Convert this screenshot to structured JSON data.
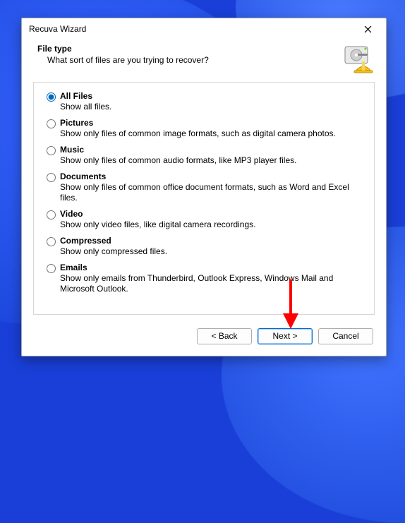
{
  "window": {
    "title": "Recuva Wizard"
  },
  "header": {
    "title": "File type",
    "subtitle": "What sort of files are you trying to recover?"
  },
  "options": [
    {
      "id": "all",
      "label": "All Files",
      "desc": "Show all files.",
      "checked": true
    },
    {
      "id": "pictures",
      "label": "Pictures",
      "desc": "Show only files of common image formats, such as digital camera photos.",
      "checked": false
    },
    {
      "id": "music",
      "label": "Music",
      "desc": "Show only files of common audio formats, like MP3 player files.",
      "checked": false
    },
    {
      "id": "documents",
      "label": "Documents",
      "desc": "Show only files of common office document formats, such as Word and Excel files.",
      "checked": false
    },
    {
      "id": "video",
      "label": "Video",
      "desc": "Show only video files, like digital camera recordings.",
      "checked": false
    },
    {
      "id": "compressed",
      "label": "Compressed",
      "desc": "Show only compressed files.",
      "checked": false
    },
    {
      "id": "emails",
      "label": "Emails",
      "desc": "Show only emails from Thunderbird, Outlook Express, Windows Mail and Microsoft Outlook.",
      "checked": false
    }
  ],
  "buttons": {
    "back": "< Back",
    "next": "Next >",
    "cancel": "Cancel"
  }
}
